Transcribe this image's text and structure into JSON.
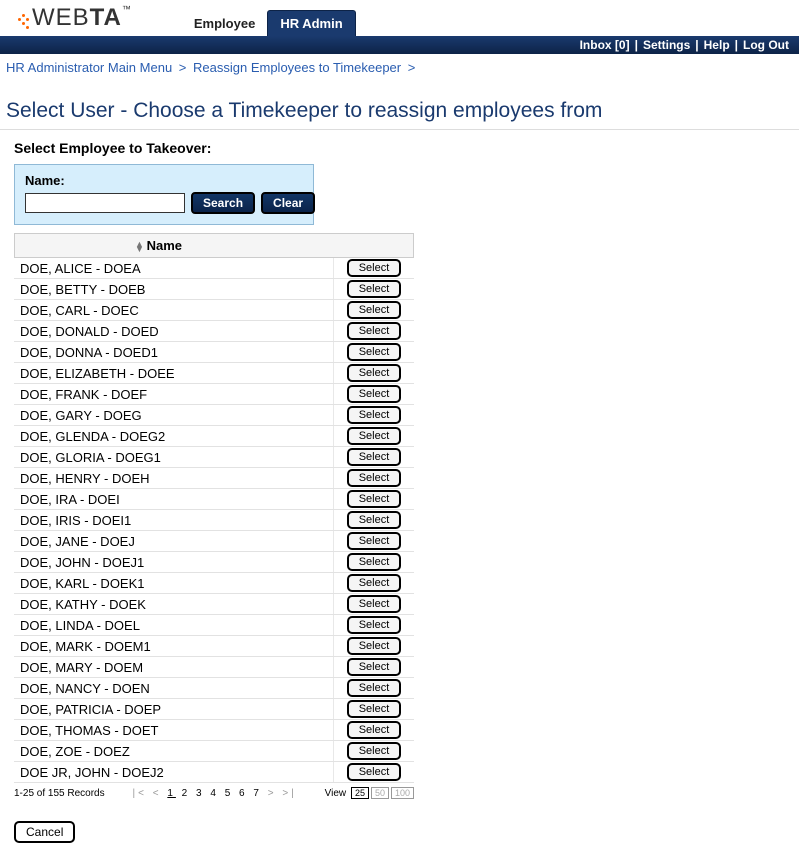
{
  "logo": {
    "text_thin": "WEB",
    "text_bold": "TA",
    "tm": "™"
  },
  "nav": {
    "tabs": [
      {
        "label": "Employee",
        "active": false
      },
      {
        "label": "HR Admin",
        "active": true
      }
    ]
  },
  "topbar": {
    "inbox": "Inbox [0]",
    "settings": "Settings",
    "help": "Help",
    "logout": "Log Out"
  },
  "breadcrumb": [
    "HR Administrator Main Menu",
    "Reassign Employees to Timekeeper"
  ],
  "page_title": "Select User - Choose a Timekeeper to reassign employees from",
  "subtitle": "Select Employee to Takeover:",
  "search": {
    "label": "Name:",
    "value": "",
    "search_btn": "Search",
    "clear_btn": "Clear"
  },
  "table": {
    "header_name": "Name",
    "select_label": "Select",
    "rows": [
      "DOE, ALICE - DOEA",
      "DOE, BETTY - DOEB",
      "DOE, CARL - DOEC",
      "DOE, DONALD - DOED",
      "DOE, DONNA - DOED1",
      "DOE, ELIZABETH - DOEE",
      "DOE, FRANK - DOEF",
      "DOE, GARY - DOEG",
      "DOE, GLENDA - DOEG2",
      "DOE, GLORIA - DOEG1",
      "DOE, HENRY - DOEH",
      "DOE, IRA - DOEI",
      "DOE, IRIS - DOEI1",
      "DOE, JANE - DOEJ",
      "DOE, JOHN - DOEJ1",
      "DOE, KARL - DOEK1",
      "DOE, KATHY - DOEK",
      "DOE, LINDA - DOEL",
      "DOE, MARK - DOEM1",
      "DOE, MARY - DOEM",
      "DOE, NANCY - DOEN",
      "DOE, PATRICIA - DOEP",
      "DOE, THOMAS - DOET",
      "DOE, ZOE - DOEZ",
      "DOE JR, JOHN - DOEJ2"
    ]
  },
  "pager": {
    "records": "1-25 of 155 Records",
    "pages": [
      "1",
      "2",
      "3",
      "4",
      "5",
      "6",
      "7"
    ],
    "current_page": "1",
    "view_label": "View",
    "view_options": [
      "25",
      "50",
      "100"
    ],
    "view_selected": "25"
  },
  "cancel_btn": "Cancel"
}
